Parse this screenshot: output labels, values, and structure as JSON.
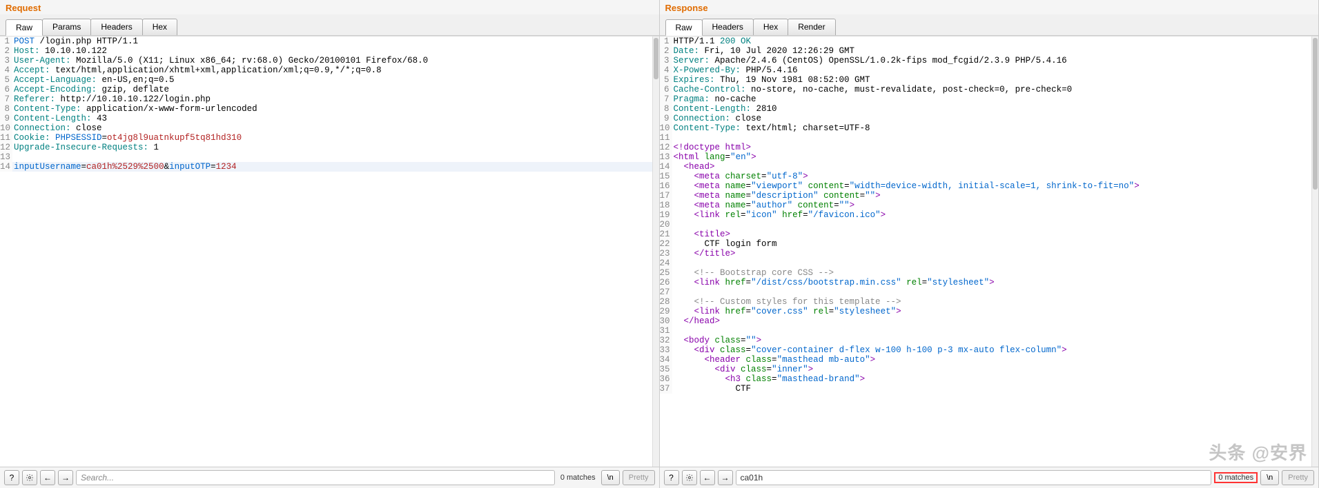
{
  "request": {
    "title": "Request",
    "tabs": [
      "Raw",
      "Params",
      "Headers",
      "Hex"
    ],
    "active_tab": 0,
    "lines": [
      {
        "n": 1,
        "segs": [
          {
            "t": "POST ",
            "c": "tok-blue"
          },
          {
            "t": "/login.php ",
            "c": ""
          },
          {
            "t": "HTTP/1.1",
            "c": ""
          }
        ]
      },
      {
        "n": 2,
        "segs": [
          {
            "t": "Host:",
            "c": "tok-teal"
          },
          {
            "t": " 10.10.10.122",
            "c": ""
          }
        ]
      },
      {
        "n": 3,
        "segs": [
          {
            "t": "User-Agent:",
            "c": "tok-teal"
          },
          {
            "t": " Mozilla/5.0 (X11; Linux x86_64; rv:68.0) Gecko/20100101 Firefox/68.0",
            "c": ""
          }
        ]
      },
      {
        "n": 4,
        "segs": [
          {
            "t": "Accept:",
            "c": "tok-teal"
          },
          {
            "t": " text/html,application/xhtml+xml,application/xml;q=0.9,*/*;q=0.8",
            "c": ""
          }
        ]
      },
      {
        "n": 5,
        "segs": [
          {
            "t": "Accept-Language:",
            "c": "tok-teal"
          },
          {
            "t": " en-US,en;q=0.5",
            "c": ""
          }
        ]
      },
      {
        "n": 6,
        "segs": [
          {
            "t": "Accept-Encoding:",
            "c": "tok-teal"
          },
          {
            "t": " gzip, deflate",
            "c": ""
          }
        ]
      },
      {
        "n": 7,
        "segs": [
          {
            "t": "Referer:",
            "c": "tok-teal"
          },
          {
            "t": " http://10.10.10.122/login.php",
            "c": ""
          }
        ]
      },
      {
        "n": 8,
        "segs": [
          {
            "t": "Content-Type:",
            "c": "tok-teal"
          },
          {
            "t": " application/x-www-form-urlencoded",
            "c": ""
          }
        ]
      },
      {
        "n": 9,
        "segs": [
          {
            "t": "Content-Length:",
            "c": "tok-teal"
          },
          {
            "t": " 43",
            "c": ""
          }
        ]
      },
      {
        "n": 10,
        "segs": [
          {
            "t": "Connection:",
            "c": "tok-teal"
          },
          {
            "t": " close",
            "c": ""
          }
        ]
      },
      {
        "n": 11,
        "segs": [
          {
            "t": "Cookie:",
            "c": "tok-teal"
          },
          {
            "t": " PHPSESSID",
            "c": "tok-blue"
          },
          {
            "t": "=",
            "c": ""
          },
          {
            "t": "ot4jg8l9uatnkupf5tq81hd310",
            "c": "tok-red"
          }
        ]
      },
      {
        "n": 12,
        "segs": [
          {
            "t": "Upgrade-Insecure-Requests:",
            "c": "tok-teal"
          },
          {
            "t": " 1",
            "c": ""
          }
        ]
      },
      {
        "n": 13,
        "segs": [
          {
            "t": "",
            "c": ""
          }
        ]
      },
      {
        "n": 14,
        "hl": true,
        "segs": [
          {
            "t": "inputUsername",
            "c": "tok-blue"
          },
          {
            "t": "=",
            "c": ""
          },
          {
            "t": "ca01h%2529%2500",
            "c": "tok-red"
          },
          {
            "t": "&",
            "c": ""
          },
          {
            "t": "inputOTP",
            "c": "tok-blue"
          },
          {
            "t": "=",
            "c": ""
          },
          {
            "t": "1234",
            "c": "tok-red"
          }
        ]
      }
    ],
    "footer": {
      "search_placeholder": "Search...",
      "match_text": "0 matches",
      "newline_label": "\\n",
      "pretty_label": "Pretty"
    }
  },
  "response": {
    "title": "Response",
    "tabs": [
      "Raw",
      "Headers",
      "Hex",
      "Render"
    ],
    "active_tab": 0,
    "lines": [
      {
        "n": 1,
        "segs": [
          {
            "t": "HTTP/1.1 ",
            "c": ""
          },
          {
            "t": "200 OK",
            "c": "tok-teal"
          }
        ]
      },
      {
        "n": 2,
        "segs": [
          {
            "t": "Date:",
            "c": "tok-teal"
          },
          {
            "t": " Fri, 10 Jul 2020 12:26:29 GMT",
            "c": ""
          }
        ]
      },
      {
        "n": 3,
        "segs": [
          {
            "t": "Server:",
            "c": "tok-teal"
          },
          {
            "t": " Apache/2.4.6 (CentOS) OpenSSL/1.0.2k-fips mod_fcgid/2.3.9 PHP/5.4.16",
            "c": ""
          }
        ]
      },
      {
        "n": 4,
        "segs": [
          {
            "t": "X-Powered-By:",
            "c": "tok-teal"
          },
          {
            "t": " PHP/5.4.16",
            "c": ""
          }
        ]
      },
      {
        "n": 5,
        "segs": [
          {
            "t": "Expires:",
            "c": "tok-teal"
          },
          {
            "t": " Thu, 19 Nov 1981 08:52:00 GMT",
            "c": ""
          }
        ]
      },
      {
        "n": 6,
        "segs": [
          {
            "t": "Cache-Control:",
            "c": "tok-teal"
          },
          {
            "t": " no-store, no-cache, must-revalidate, post-check=0, pre-check=0",
            "c": ""
          }
        ]
      },
      {
        "n": 7,
        "segs": [
          {
            "t": "Pragma:",
            "c": "tok-teal"
          },
          {
            "t": " no-cache",
            "c": ""
          }
        ]
      },
      {
        "n": 8,
        "segs": [
          {
            "t": "Content-Length:",
            "c": "tok-teal"
          },
          {
            "t": " 2810",
            "c": ""
          }
        ]
      },
      {
        "n": 9,
        "segs": [
          {
            "t": "Connection:",
            "c": "tok-teal"
          },
          {
            "t": " close",
            "c": ""
          }
        ]
      },
      {
        "n": 10,
        "segs": [
          {
            "t": "Content-Type:",
            "c": "tok-teal"
          },
          {
            "t": " text/html; charset=UTF-8",
            "c": ""
          }
        ]
      },
      {
        "n": 11,
        "segs": [
          {
            "t": "",
            "c": ""
          }
        ]
      },
      {
        "n": 12,
        "segs": [
          {
            "t": "<!doctype html>",
            "c": "tok-purple"
          }
        ]
      },
      {
        "n": 13,
        "segs": [
          {
            "t": "<",
            "c": "tok-purple"
          },
          {
            "t": "html ",
            "c": "tok-purple"
          },
          {
            "t": "lang",
            "c": "tok-green"
          },
          {
            "t": "=",
            "c": ""
          },
          {
            "t": "\"en\"",
            "c": "tok-blue"
          },
          {
            "t": ">",
            "c": "tok-purple"
          }
        ]
      },
      {
        "n": 14,
        "segs": [
          {
            "t": "  <",
            "c": "tok-purple"
          },
          {
            "t": "head",
            "c": "tok-purple"
          },
          {
            "t": ">",
            "c": "tok-purple"
          }
        ]
      },
      {
        "n": 15,
        "segs": [
          {
            "t": "    <",
            "c": "tok-purple"
          },
          {
            "t": "meta ",
            "c": "tok-purple"
          },
          {
            "t": "charset",
            "c": "tok-green"
          },
          {
            "t": "=",
            "c": ""
          },
          {
            "t": "\"utf-8\"",
            "c": "tok-blue"
          },
          {
            "t": ">",
            "c": "tok-purple"
          }
        ]
      },
      {
        "n": 16,
        "segs": [
          {
            "t": "    <",
            "c": "tok-purple"
          },
          {
            "t": "meta ",
            "c": "tok-purple"
          },
          {
            "t": "name",
            "c": "tok-green"
          },
          {
            "t": "=",
            "c": ""
          },
          {
            "t": "\"viewport\" ",
            "c": "tok-blue"
          },
          {
            "t": "content",
            "c": "tok-green"
          },
          {
            "t": "=",
            "c": ""
          },
          {
            "t": "\"width=device-width, initial-scale=1, shrink-to-fit=no\"",
            "c": "tok-blue"
          },
          {
            "t": ">",
            "c": "tok-purple"
          }
        ]
      },
      {
        "n": 17,
        "segs": [
          {
            "t": "    <",
            "c": "tok-purple"
          },
          {
            "t": "meta ",
            "c": "tok-purple"
          },
          {
            "t": "name",
            "c": "tok-green"
          },
          {
            "t": "=",
            "c": ""
          },
          {
            "t": "\"description\" ",
            "c": "tok-blue"
          },
          {
            "t": "content",
            "c": "tok-green"
          },
          {
            "t": "=",
            "c": ""
          },
          {
            "t": "\"\"",
            "c": "tok-blue"
          },
          {
            "t": ">",
            "c": "tok-purple"
          }
        ]
      },
      {
        "n": 18,
        "segs": [
          {
            "t": "    <",
            "c": "tok-purple"
          },
          {
            "t": "meta ",
            "c": "tok-purple"
          },
          {
            "t": "name",
            "c": "tok-green"
          },
          {
            "t": "=",
            "c": ""
          },
          {
            "t": "\"author\" ",
            "c": "tok-blue"
          },
          {
            "t": "content",
            "c": "tok-green"
          },
          {
            "t": "=",
            "c": ""
          },
          {
            "t": "\"\"",
            "c": "tok-blue"
          },
          {
            "t": ">",
            "c": "tok-purple"
          }
        ]
      },
      {
        "n": 19,
        "segs": [
          {
            "t": "    <",
            "c": "tok-purple"
          },
          {
            "t": "link ",
            "c": "tok-purple"
          },
          {
            "t": "rel",
            "c": "tok-green"
          },
          {
            "t": "=",
            "c": ""
          },
          {
            "t": "\"icon\" ",
            "c": "tok-blue"
          },
          {
            "t": "href",
            "c": "tok-green"
          },
          {
            "t": "=",
            "c": ""
          },
          {
            "t": "\"/favicon.ico\"",
            "c": "tok-blue"
          },
          {
            "t": ">",
            "c": "tok-purple"
          }
        ]
      },
      {
        "n": 20,
        "segs": [
          {
            "t": "",
            "c": ""
          }
        ]
      },
      {
        "n": 21,
        "segs": [
          {
            "t": "    <",
            "c": "tok-purple"
          },
          {
            "t": "title",
            "c": "tok-purple"
          },
          {
            "t": ">",
            "c": "tok-purple"
          }
        ]
      },
      {
        "n": 22,
        "segs": [
          {
            "t": "      CTF login form",
            "c": ""
          }
        ]
      },
      {
        "n": 23,
        "segs": [
          {
            "t": "    </",
            "c": "tok-purple"
          },
          {
            "t": "title",
            "c": "tok-purple"
          },
          {
            "t": ">",
            "c": "tok-purple"
          }
        ]
      },
      {
        "n": 24,
        "segs": [
          {
            "t": "",
            "c": ""
          }
        ]
      },
      {
        "n": 25,
        "segs": [
          {
            "t": "    <!-- Bootstrap core CSS -->",
            "c": "tok-gray"
          }
        ]
      },
      {
        "n": 26,
        "segs": [
          {
            "t": "    <",
            "c": "tok-purple"
          },
          {
            "t": "link ",
            "c": "tok-purple"
          },
          {
            "t": "href",
            "c": "tok-green"
          },
          {
            "t": "=",
            "c": ""
          },
          {
            "t": "\"/dist/css/bootstrap.min.css\" ",
            "c": "tok-blue"
          },
          {
            "t": "rel",
            "c": "tok-green"
          },
          {
            "t": "=",
            "c": ""
          },
          {
            "t": "\"stylesheet\"",
            "c": "tok-blue"
          },
          {
            "t": ">",
            "c": "tok-purple"
          }
        ]
      },
      {
        "n": 27,
        "segs": [
          {
            "t": "",
            "c": ""
          }
        ]
      },
      {
        "n": 28,
        "segs": [
          {
            "t": "    <!-- Custom styles for this template -->",
            "c": "tok-gray"
          }
        ]
      },
      {
        "n": 29,
        "segs": [
          {
            "t": "    <",
            "c": "tok-purple"
          },
          {
            "t": "link ",
            "c": "tok-purple"
          },
          {
            "t": "href",
            "c": "tok-green"
          },
          {
            "t": "=",
            "c": ""
          },
          {
            "t": "\"cover.css\" ",
            "c": "tok-blue"
          },
          {
            "t": "rel",
            "c": "tok-green"
          },
          {
            "t": "=",
            "c": ""
          },
          {
            "t": "\"stylesheet\"",
            "c": "tok-blue"
          },
          {
            "t": ">",
            "c": "tok-purple"
          }
        ]
      },
      {
        "n": 30,
        "segs": [
          {
            "t": "  </",
            "c": "tok-purple"
          },
          {
            "t": "head",
            "c": "tok-purple"
          },
          {
            "t": ">",
            "c": "tok-purple"
          }
        ]
      },
      {
        "n": 31,
        "segs": [
          {
            "t": "",
            "c": ""
          }
        ]
      },
      {
        "n": 32,
        "segs": [
          {
            "t": "  <",
            "c": "tok-purple"
          },
          {
            "t": "body ",
            "c": "tok-purple"
          },
          {
            "t": "class",
            "c": "tok-green"
          },
          {
            "t": "=",
            "c": ""
          },
          {
            "t": "\"\"",
            "c": "tok-blue"
          },
          {
            "t": ">",
            "c": "tok-purple"
          }
        ]
      },
      {
        "n": 33,
        "segs": [
          {
            "t": "    <",
            "c": "tok-purple"
          },
          {
            "t": "div ",
            "c": "tok-purple"
          },
          {
            "t": "class",
            "c": "tok-green"
          },
          {
            "t": "=",
            "c": ""
          },
          {
            "t": "\"cover-container d-flex w-100 h-100 p-3 mx-auto flex-column\"",
            "c": "tok-blue"
          },
          {
            "t": ">",
            "c": "tok-purple"
          }
        ]
      },
      {
        "n": 34,
        "segs": [
          {
            "t": "      <",
            "c": "tok-purple"
          },
          {
            "t": "header ",
            "c": "tok-purple"
          },
          {
            "t": "class",
            "c": "tok-green"
          },
          {
            "t": "=",
            "c": ""
          },
          {
            "t": "\"masthead mb-auto\"",
            "c": "tok-blue"
          },
          {
            "t": ">",
            "c": "tok-purple"
          }
        ]
      },
      {
        "n": 35,
        "segs": [
          {
            "t": "        <",
            "c": "tok-purple"
          },
          {
            "t": "div ",
            "c": "tok-purple"
          },
          {
            "t": "class",
            "c": "tok-green"
          },
          {
            "t": "=",
            "c": ""
          },
          {
            "t": "\"inner\"",
            "c": "tok-blue"
          },
          {
            "t": ">",
            "c": "tok-purple"
          }
        ]
      },
      {
        "n": 36,
        "segs": [
          {
            "t": "          <",
            "c": "tok-purple"
          },
          {
            "t": "h3 ",
            "c": "tok-purple"
          },
          {
            "t": "class",
            "c": "tok-green"
          },
          {
            "t": "=",
            "c": ""
          },
          {
            "t": "\"masthead-brand\"",
            "c": "tok-blue"
          },
          {
            "t": ">",
            "c": "tok-purple"
          }
        ]
      },
      {
        "n": 37,
        "segs": [
          {
            "t": "            CTF",
            "c": ""
          }
        ]
      }
    ],
    "footer": {
      "search_value": "ca01h",
      "match_text": "0 matches",
      "newline_label": "\\n",
      "pretty_label": "Pretty"
    }
  },
  "watermark": "头条 @安界",
  "line_offset_response": 11
}
